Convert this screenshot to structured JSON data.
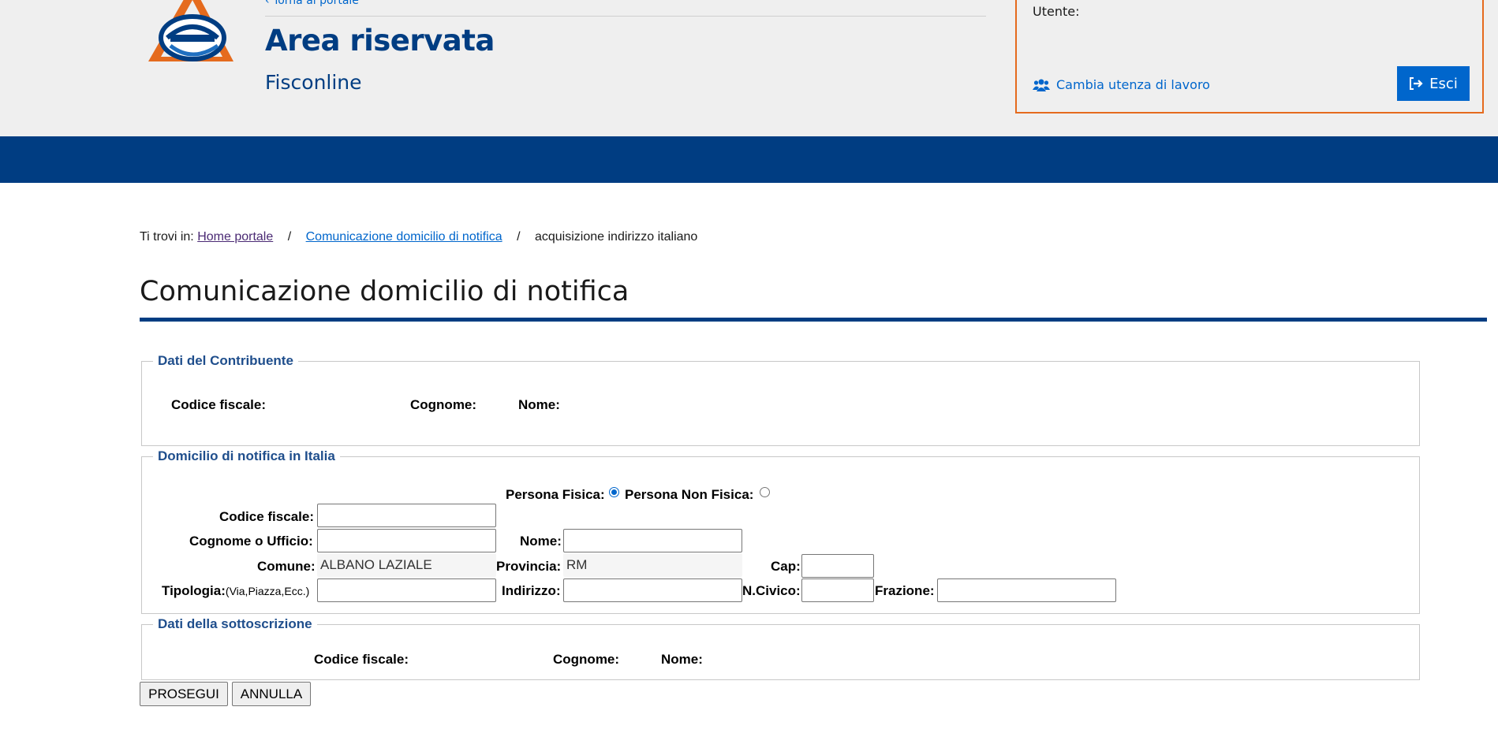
{
  "header": {
    "back_link": "Torna al portale",
    "title": "Area riservata",
    "subtitle": "Fisconline",
    "user_label": "Utente:",
    "change_user": "Cambia utenza di lavoro",
    "exit": "Esci"
  },
  "breadcrumb": {
    "prefix": "Ti trovi in:",
    "items": [
      "Home portale",
      "Comunicazione domicilio di notifica",
      "acquisizione indirizzo italiano"
    ],
    "separator": "/"
  },
  "page_title": "Comunicazione domicilio di notifica",
  "contribuente": {
    "legend": "Dati del Contribuente",
    "codice_fiscale": "Codice fiscale:",
    "cognome": "Cognome:",
    "nome": "Nome:"
  },
  "domicilio": {
    "legend": "Domicilio di notifica in Italia",
    "persona_fisica": "Persona Fisica:",
    "persona_non_fisica": "Persona Non Fisica:",
    "codice_fiscale": "Codice fiscale:",
    "cognome_ufficio": "Cognome o Ufficio:",
    "nome": "Nome:",
    "comune": "Comune:",
    "comune_value": "ALBANO LAZIALE",
    "provincia": "Provincia:",
    "provincia_value": "RM",
    "cap": "Cap:",
    "tipologia": "Tipologia:",
    "tipologia_hint": "(Via,Piazza,Ecc.)",
    "indirizzo": "Indirizzo:",
    "civico": "N.Civico:",
    "frazione": "Frazione:"
  },
  "sottoscrizione": {
    "legend": "Dati della sottoscrizione",
    "codice_fiscale": "Codice fiscale:",
    "cognome": "Cognome:",
    "nome": "Nome:"
  },
  "buttons": {
    "prosegui": "PROSEGUI",
    "annulla": "ANNULLA"
  },
  "colors": {
    "brand_blue": "#003d82",
    "link_blue": "#0066cc",
    "accent_orange": "#e56b1e",
    "legend_blue": "#1f4e8c"
  },
  "icons": {
    "logo": "agenzia-entrate-logo",
    "back": "chevron-left-icon",
    "users": "users-icon",
    "exit": "sign-out-icon"
  }
}
